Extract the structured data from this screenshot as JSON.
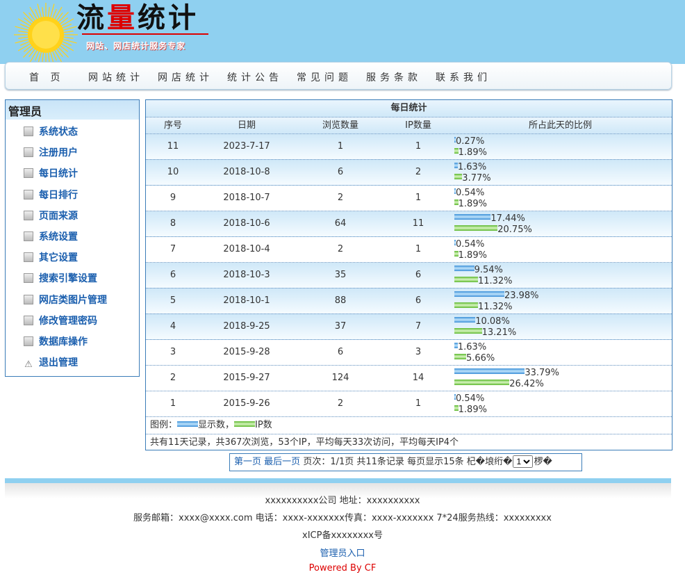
{
  "brand": {
    "title_a": "流",
    "title_b": "量",
    "title_c": "统计",
    "subtitle": "网站、网店统计服务专家"
  },
  "nav": [
    "首 页",
    "网站统计",
    "网店统计",
    "统计公告",
    "常见问题",
    "服务条款",
    "联系我们"
  ],
  "sidebar": {
    "title": "管理员",
    "items": [
      {
        "label": "系统状态",
        "icon": "system-status-icon"
      },
      {
        "label": "注册用户",
        "icon": "registered-users-icon"
      },
      {
        "label": "每日统计",
        "icon": "daily-stats-icon"
      },
      {
        "label": "每日排行",
        "icon": "daily-ranking-icon"
      },
      {
        "label": "页面来源",
        "icon": "page-source-icon"
      },
      {
        "label": "系统设置",
        "icon": "system-settings-icon"
      },
      {
        "label": "其它设置",
        "icon": "other-settings-icon"
      },
      {
        "label": "搜索引擎设置",
        "icon": "search-engine-settings-icon"
      },
      {
        "label": "网店类图片管理",
        "icon": "image-management-icon"
      },
      {
        "label": "修改管理密码",
        "icon": "change-password-icon"
      },
      {
        "label": "数据库操作",
        "icon": "database-icon"
      },
      {
        "label": "退出管理",
        "icon": "warning-icon"
      }
    ]
  },
  "table": {
    "title": "每日统计",
    "headers": [
      "序号",
      "日期",
      "浏览数量",
      "IP数量",
      "所占此天的比例"
    ],
    "rows": [
      {
        "no": "11",
        "date": "2023-7-17",
        "views": "1",
        "ips": "1",
        "view_pct": "0.27%",
        "ip_pct": "1.89%"
      },
      {
        "no": "10",
        "date": "2018-10-8",
        "views": "6",
        "ips": "2",
        "view_pct": "1.63%",
        "ip_pct": "3.77%"
      },
      {
        "no": "9",
        "date": "2018-10-7",
        "views": "2",
        "ips": "1",
        "view_pct": "0.54%",
        "ip_pct": "1.89%"
      },
      {
        "no": "8",
        "date": "2018-10-6",
        "views": "64",
        "ips": "11",
        "view_pct": "17.44%",
        "ip_pct": "20.75%"
      },
      {
        "no": "7",
        "date": "2018-10-4",
        "views": "2",
        "ips": "1",
        "view_pct": "0.54%",
        "ip_pct": "1.89%"
      },
      {
        "no": "6",
        "date": "2018-10-3",
        "views": "35",
        "ips": "6",
        "view_pct": "9.54%",
        "ip_pct": "11.32%"
      },
      {
        "no": "5",
        "date": "2018-10-1",
        "views": "88",
        "ips": "6",
        "view_pct": "23.98%",
        "ip_pct": "11.32%"
      },
      {
        "no": "4",
        "date": "2018-9-25",
        "views": "37",
        "ips": "7",
        "view_pct": "10.08%",
        "ip_pct": "13.21%"
      },
      {
        "no": "3",
        "date": "2015-9-28",
        "views": "6",
        "ips": "3",
        "view_pct": "1.63%",
        "ip_pct": "5.66%"
      },
      {
        "no": "2",
        "date": "2015-9-27",
        "views": "124",
        "ips": "14",
        "view_pct": "33.79%",
        "ip_pct": "26.42%"
      },
      {
        "no": "1",
        "date": "2015-9-26",
        "views": "2",
        "ips": "1",
        "view_pct": "0.54%",
        "ip_pct": "1.89%"
      }
    ],
    "legend": {
      "prefix": "图例：",
      "views": "显示数，",
      "ips": "IP数"
    },
    "summary": "共有11天记录，共367次浏览，53个IP，平均每天33次访问，平均每天IP4个"
  },
  "pager": {
    "first": "第一页",
    "last": "最后一页",
    "page_info": "页次：1/1页",
    "record_info": "共11条记录",
    "per_page": "每页显示15条",
    "goto_prefix": "杞�埌绗�",
    "goto_suffix": "椤�",
    "selected_page": "1"
  },
  "footer": {
    "line1": "xxxxxxxxxx公司 地址：xxxxxxxxxx",
    "line2": "服务邮箱：xxxx@xxxx.com 电话：xxxx-xxxxxxx传真：xxxx-xxxxxxx 7*24服务热线：xxxxxxxxx",
    "line3": "xICP备xxxxxxxx号",
    "admin_link": "管理员入口",
    "powered": "Powered By CF"
  },
  "colors": {
    "view_bar": "#3a8fd8",
    "ip_bar": "#5cb82e",
    "link": "#1b5fae",
    "border": "#3a7cb8",
    "header_bg": "#8fd0f0"
  }
}
